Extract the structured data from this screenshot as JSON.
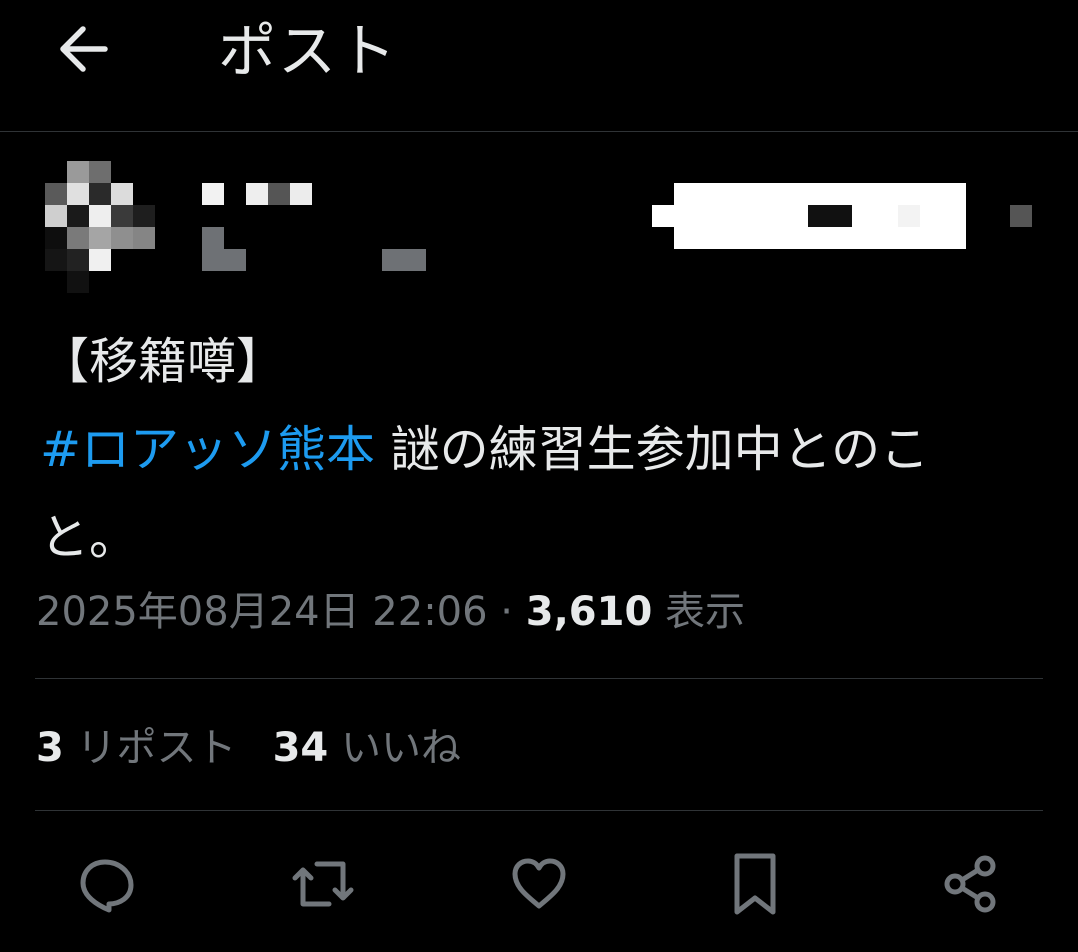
{
  "header": {
    "title": "ポスト",
    "back_icon": "arrow-left-icon"
  },
  "post": {
    "text_bracket": "【移籍噂】",
    "hashtag": "#ロアッソ熊本",
    "text_after_hashtag": " 謎の練習生参加中とのこ",
    "text_wrap": "と。",
    "timestamp": "2025年08月24日 22:06",
    "separator": " · ",
    "views_count": "3,610",
    "views_label": " 表示"
  },
  "stats": {
    "reposts_count": "3",
    "reposts_label": " リポスト",
    "likes_count": "34",
    "likes_label": " いいね"
  },
  "actions": [
    {
      "name": "reply",
      "icon": "reply-icon"
    },
    {
      "name": "repost",
      "icon": "repost-icon"
    },
    {
      "name": "like",
      "icon": "heart-icon"
    },
    {
      "name": "bookmark",
      "icon": "bookmark-icon"
    },
    {
      "name": "share",
      "icon": "share-icon"
    }
  ],
  "colors": {
    "background": "#000000",
    "text": "#e7e9ea",
    "secondary": "#71767b",
    "link": "#1d9bf0",
    "border": "#2f3336"
  }
}
